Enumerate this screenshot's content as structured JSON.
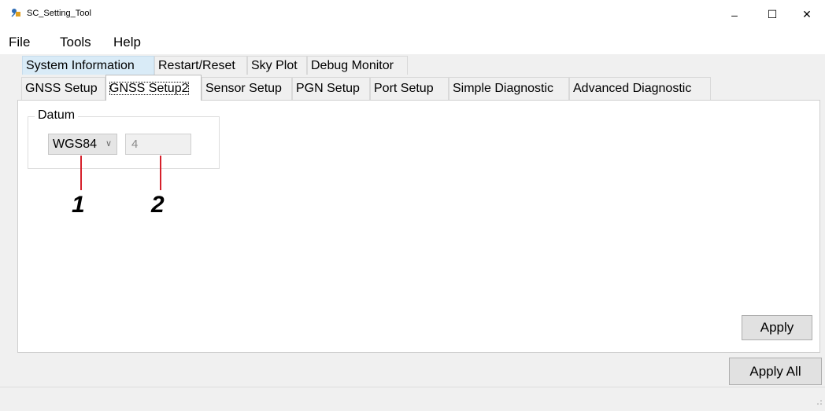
{
  "window": {
    "title": "SC_Setting_Tool",
    "controls": {
      "minimize": "–",
      "maximize": "☐",
      "close": "✕"
    }
  },
  "menu": {
    "items": [
      "File",
      "Tools",
      "Help"
    ]
  },
  "tabs_row1": [
    "System Information",
    "Restart/Reset",
    "Sky Plot",
    "Debug Monitor"
  ],
  "tabs_row2": [
    "GNSS Setup",
    "GNSS Setup2",
    "Sensor Setup",
    "PGN Setup",
    "Port Setup",
    "Simple Diagnostic",
    "Advanced Diagnostic"
  ],
  "active_tab": "GNSS Setup2",
  "datum": {
    "group_label": "Datum",
    "select_value": "WGS84",
    "number_value": "4"
  },
  "callouts": [
    "1",
    "2"
  ],
  "buttons": {
    "apply": "Apply",
    "apply_all": "Apply All"
  },
  "colors": {
    "callout": "#d6202b",
    "selected_tab": "#d9ebf7"
  },
  "icons": {
    "app": "satellite-app-icon",
    "dropdown": "chevron-down-icon"
  }
}
